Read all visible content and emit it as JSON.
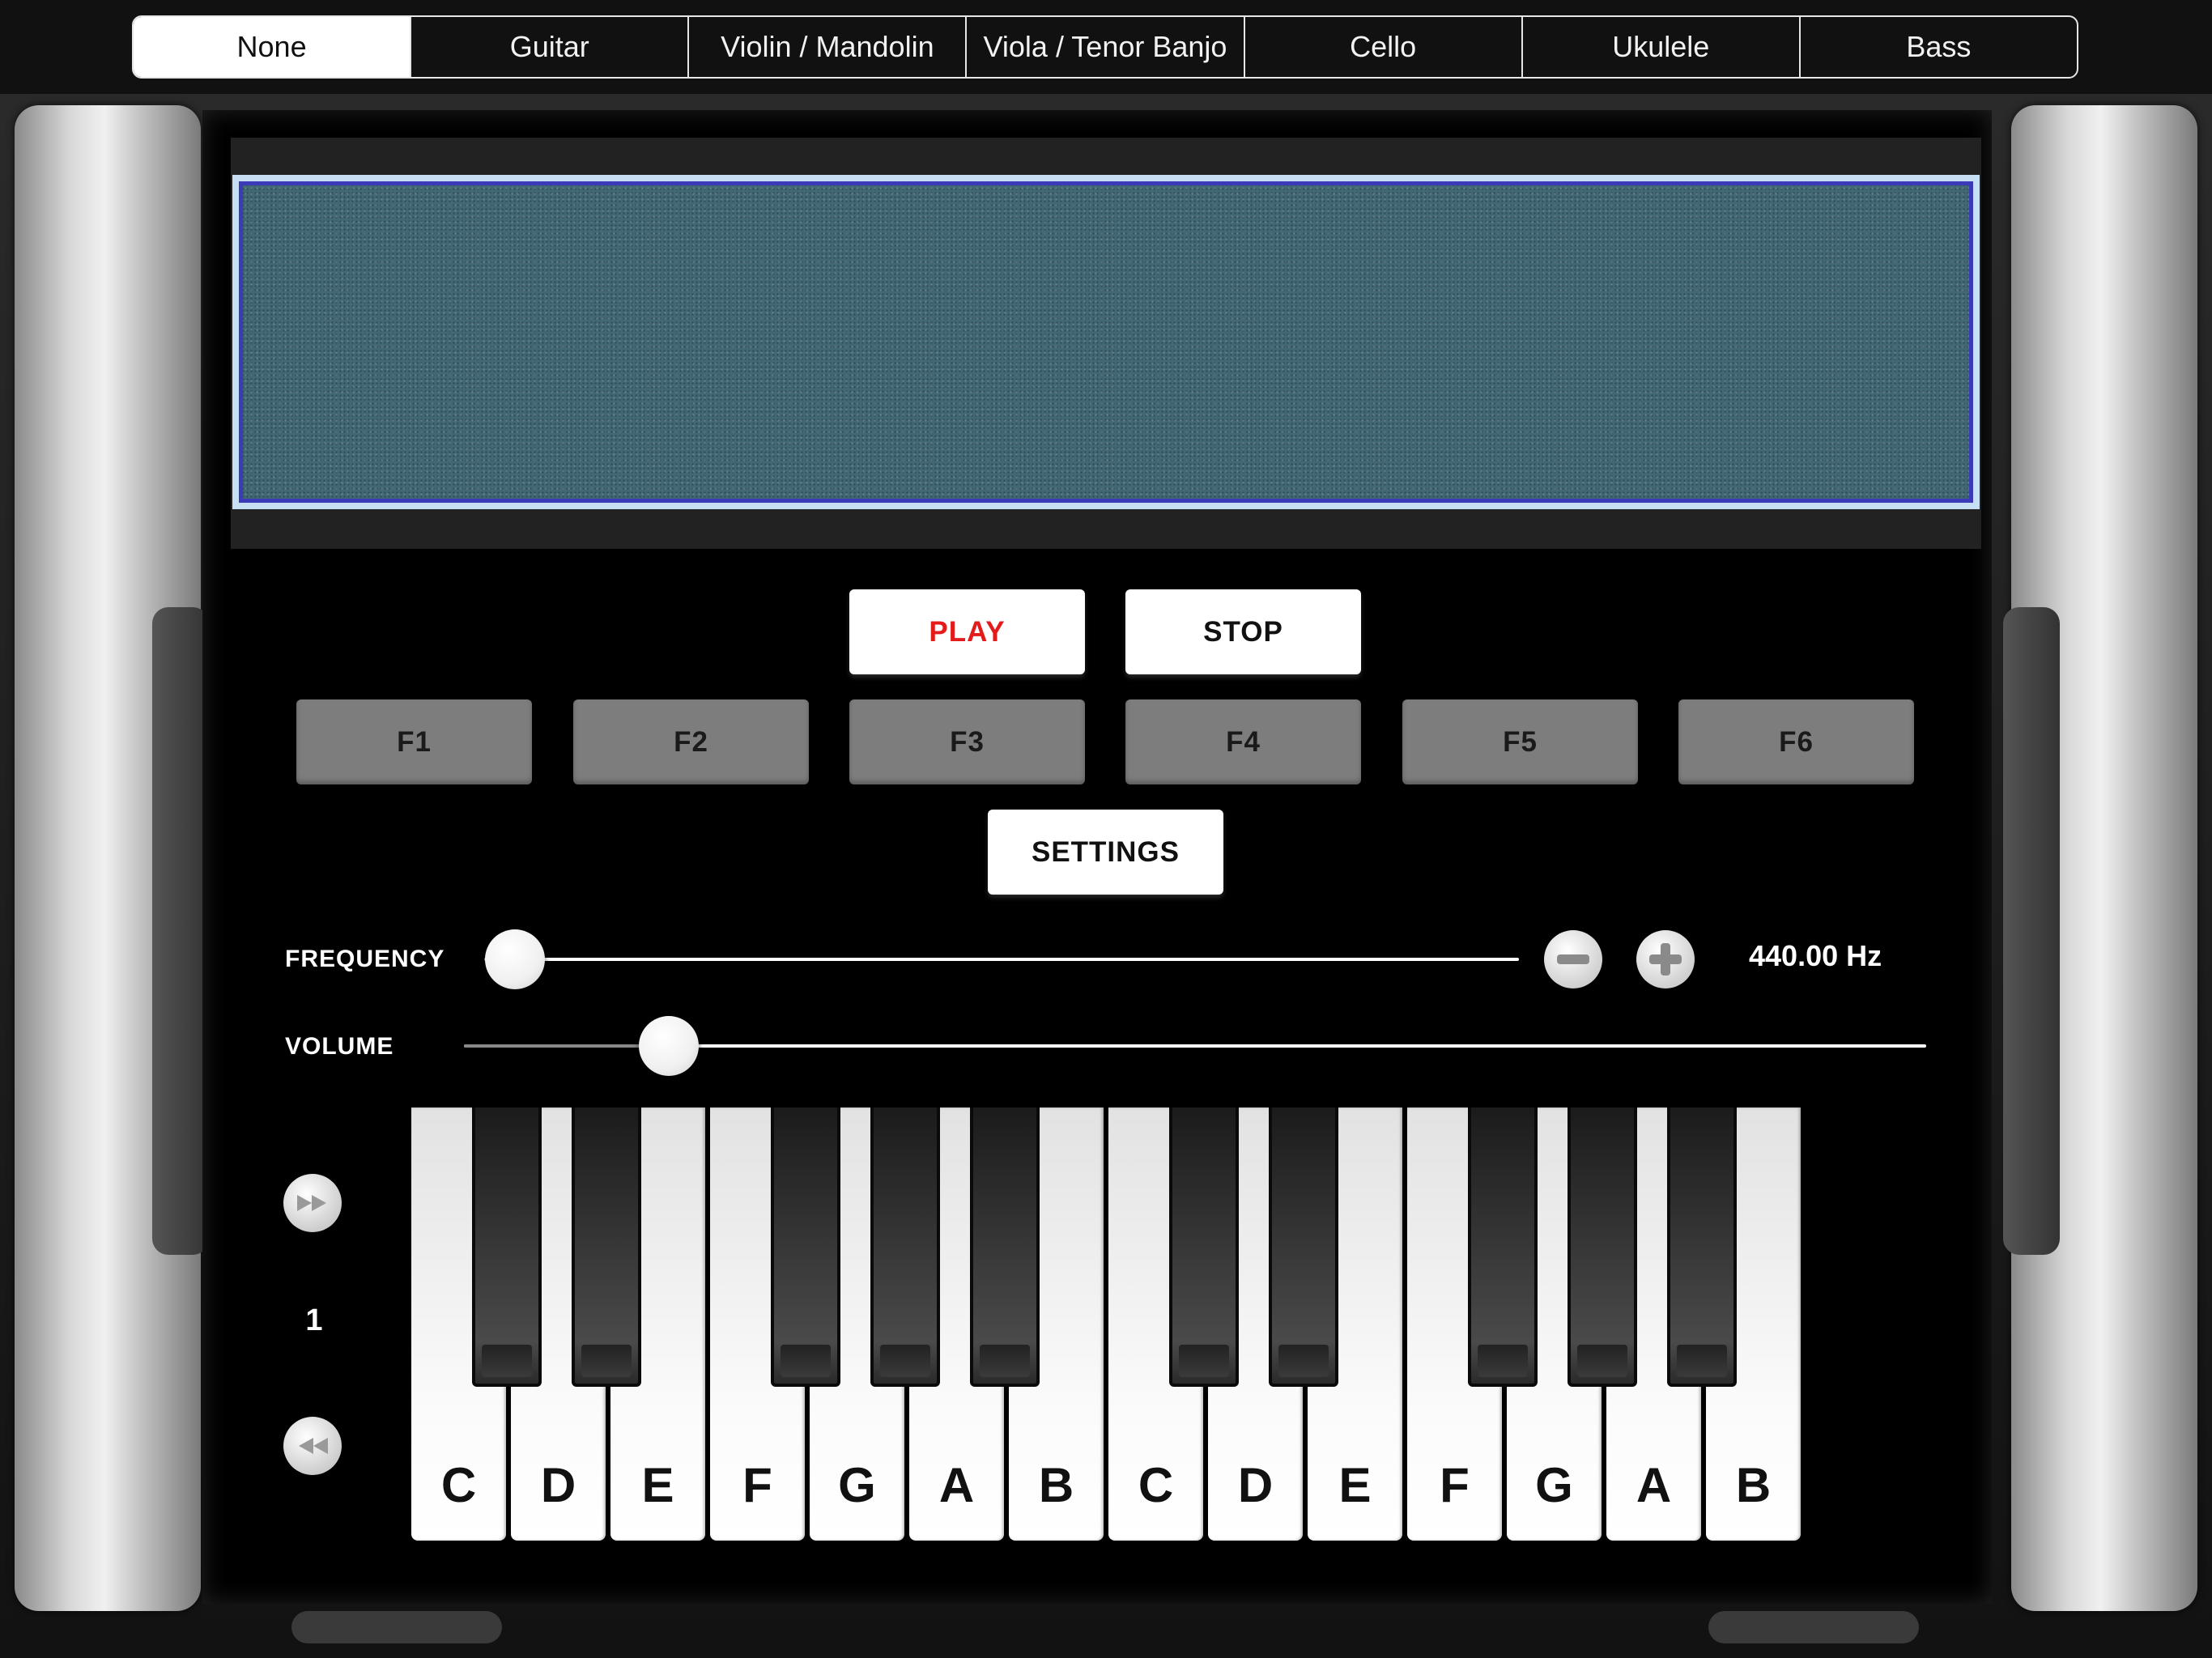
{
  "tabs": {
    "items": [
      "None",
      "Guitar",
      "Violin / Mandolin",
      "Viola / Tenor Banjo",
      "Cello",
      "Ukulele",
      "Bass"
    ],
    "selected": "None"
  },
  "controls": {
    "play_label": "PLAY",
    "stop_label": "STOP",
    "settings_label": "SETTINGS",
    "function_keys": [
      "F1",
      "F2",
      "F3",
      "F4",
      "F5",
      "F6"
    ]
  },
  "frequency": {
    "label": "FREQUENCY",
    "readout": "440.00 Hz",
    "slider_fraction": 0.03
  },
  "volume": {
    "label": "VOLUME",
    "slider_fraction": 0.14
  },
  "octave": {
    "value": "1",
    "up_icon": "fast-forward-icon",
    "down_icon": "rewind-icon"
  },
  "keyboard": {
    "white_keys": [
      "C",
      "D",
      "E",
      "F",
      "G",
      "A",
      "B",
      "C",
      "D",
      "E",
      "F",
      "G",
      "A",
      "B"
    ]
  },
  "colors": {
    "play_text": "#e31b1b",
    "display_screen": "#426876",
    "display_border": "#3b3ab8"
  }
}
